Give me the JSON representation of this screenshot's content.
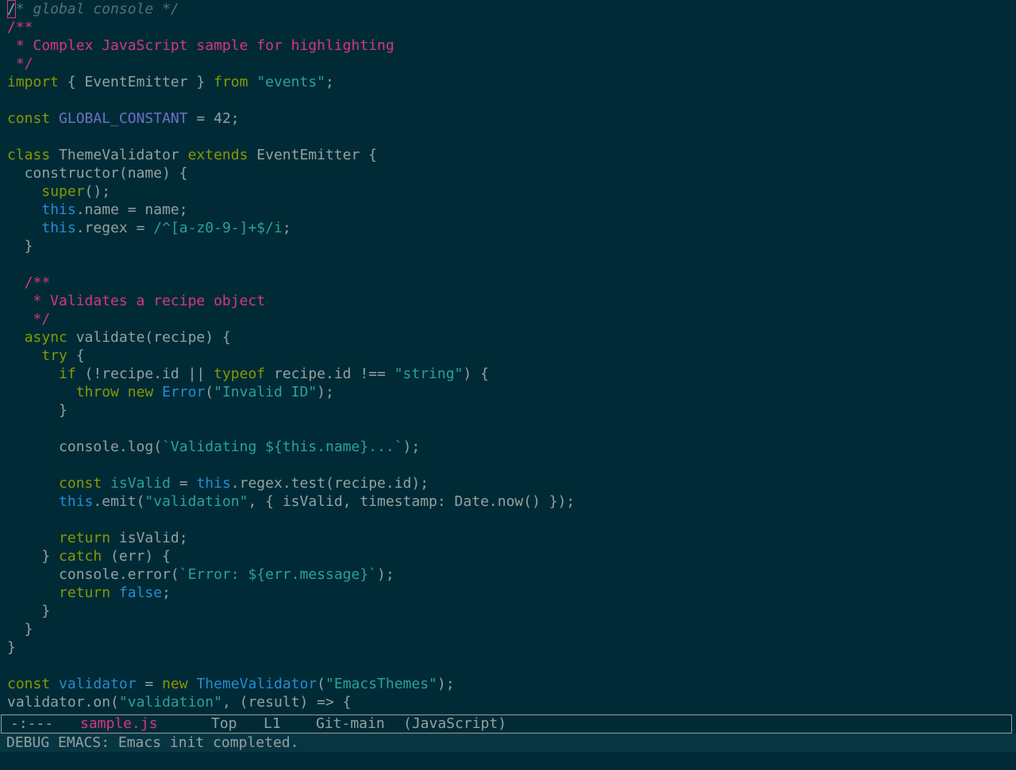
{
  "colors": {
    "background": "#002b36",
    "default": "#93a1a1",
    "comment_muted": "#586e75",
    "doc_comment": "#d33682",
    "keyword": "#859900",
    "string": "#2aa198",
    "builtin": "#268bd2",
    "constant": "#6c71c4",
    "type": "#b58900"
  },
  "editor": {
    "lines": [
      [
        [
          "/",
          "cursor"
        ],
        [
          "* global console */",
          "cm"
        ]
      ],
      [
        [
          "/**",
          "dc"
        ]
      ],
      [
        [
          " * Complex JavaScript sample for highlighting",
          "dc"
        ]
      ],
      [
        [
          " */",
          "dc"
        ]
      ],
      [
        [
          "import",
          "kw"
        ],
        [
          " { EventEmitter } ",
          "df"
        ],
        [
          "from",
          "kw"
        ],
        [
          " ",
          "df"
        ],
        [
          "\"events\"",
          "str"
        ],
        [
          ";",
          "df"
        ]
      ],
      [],
      [
        [
          "const",
          "kw"
        ],
        [
          " ",
          "df"
        ],
        [
          "GLOBAL_CONSTANT",
          "cn"
        ],
        [
          " = 42;",
          "df"
        ]
      ],
      [],
      [
        [
          "class",
          "kw"
        ],
        [
          " ThemeValidator ",
          "df"
        ],
        [
          "extends",
          "kw"
        ],
        [
          " EventEmitter {",
          "df"
        ]
      ],
      [
        [
          "  constructor(name) {",
          "df"
        ]
      ],
      [
        [
          "    ",
          "df"
        ],
        [
          "super",
          "kw"
        ],
        [
          "();",
          "df"
        ]
      ],
      [
        [
          "    ",
          "df"
        ],
        [
          "this",
          "bi"
        ],
        [
          ".name = name;",
          "df"
        ]
      ],
      [
        [
          "    ",
          "df"
        ],
        [
          "this",
          "bi"
        ],
        [
          ".regex = ",
          "df"
        ],
        [
          "/^[a-z0-9-]+$/i",
          "str"
        ],
        [
          ";",
          "df"
        ]
      ],
      [
        [
          "  }",
          "df"
        ]
      ],
      [],
      [
        [
          "  /**",
          "dc"
        ]
      ],
      [
        [
          "   * Validates a recipe object",
          "dc"
        ]
      ],
      [
        [
          "   */",
          "dc"
        ]
      ],
      [
        [
          "  ",
          "df"
        ],
        [
          "async",
          "kw"
        ],
        [
          " validate(recipe) {",
          "df"
        ]
      ],
      [
        [
          "    ",
          "df"
        ],
        [
          "try",
          "kw"
        ],
        [
          " {",
          "df"
        ]
      ],
      [
        [
          "      ",
          "df"
        ],
        [
          "if",
          "kw"
        ],
        [
          " (!recipe.id || ",
          "df"
        ],
        [
          "typeof",
          "kw"
        ],
        [
          " recipe.id !== ",
          "df"
        ],
        [
          "\"string\"",
          "str"
        ],
        [
          ") {",
          "df"
        ]
      ],
      [
        [
          "        ",
          "df"
        ],
        [
          "throw",
          "kw"
        ],
        [
          " ",
          "df"
        ],
        [
          "new",
          "kw"
        ],
        [
          " ",
          "df"
        ],
        [
          "Error",
          "bi"
        ],
        [
          "(",
          "df"
        ],
        [
          "\"Invalid ID\"",
          "str"
        ],
        [
          ");",
          "df"
        ]
      ],
      [
        [
          "      }",
          "df"
        ]
      ],
      [],
      [
        [
          "      console.log(",
          "df"
        ],
        [
          "`Validating ${this.name}...`",
          "str"
        ],
        [
          ");",
          "df"
        ]
      ],
      [],
      [
        [
          "      ",
          "df"
        ],
        [
          "const",
          "kw"
        ],
        [
          " ",
          "df"
        ],
        [
          "isValid",
          "str"
        ],
        [
          " = ",
          "df"
        ],
        [
          "this",
          "bi"
        ],
        [
          ".regex.test(recipe.id);",
          "df"
        ]
      ],
      [
        [
          "      ",
          "df"
        ],
        [
          "this",
          "bi"
        ],
        [
          ".emit(",
          "df"
        ],
        [
          "\"validation\"",
          "str"
        ],
        [
          ", { isValid, timestamp: Date.now() });",
          "df"
        ]
      ],
      [],
      [
        [
          "      ",
          "df"
        ],
        [
          "return",
          "kw"
        ],
        [
          " isValid;",
          "df"
        ]
      ],
      [
        [
          "    } ",
          "df"
        ],
        [
          "catch",
          "kw"
        ],
        [
          " (err) {",
          "df"
        ]
      ],
      [
        [
          "      console.error(",
          "df"
        ],
        [
          "`Error: ${err.message}`",
          "str"
        ],
        [
          ");",
          "df"
        ]
      ],
      [
        [
          "      ",
          "df"
        ],
        [
          "return",
          "kw"
        ],
        [
          " ",
          "df"
        ],
        [
          "false",
          "bi"
        ],
        [
          ";",
          "df"
        ]
      ],
      [
        [
          "    }",
          "df"
        ]
      ],
      [
        [
          "  }",
          "df"
        ]
      ],
      [
        [
          "}",
          "df"
        ]
      ],
      [],
      [
        [
          "const",
          "kw"
        ],
        [
          " ",
          "df"
        ],
        [
          "validator",
          "bi"
        ],
        [
          " = ",
          "df"
        ],
        [
          "new",
          "kw"
        ],
        [
          " ",
          "df"
        ],
        [
          "ThemeValidator",
          "bi"
        ],
        [
          "(",
          "df"
        ],
        [
          "\"EmacsThemes\"",
          "str"
        ],
        [
          ");",
          "df"
        ]
      ],
      [
        [
          "validator.on(",
          "df"
        ],
        [
          "\"validation\"",
          "str"
        ],
        [
          ", (result) => {",
          "df"
        ]
      ]
    ]
  },
  "modeline": {
    "status": "-:---",
    "buffer_name": "sample.js",
    "position": "Top",
    "line": "L1",
    "vc": "Git-main",
    "mode": "(JavaScript)"
  },
  "echo_area": {
    "message": "DEBUG EMACS: Emacs init completed."
  }
}
